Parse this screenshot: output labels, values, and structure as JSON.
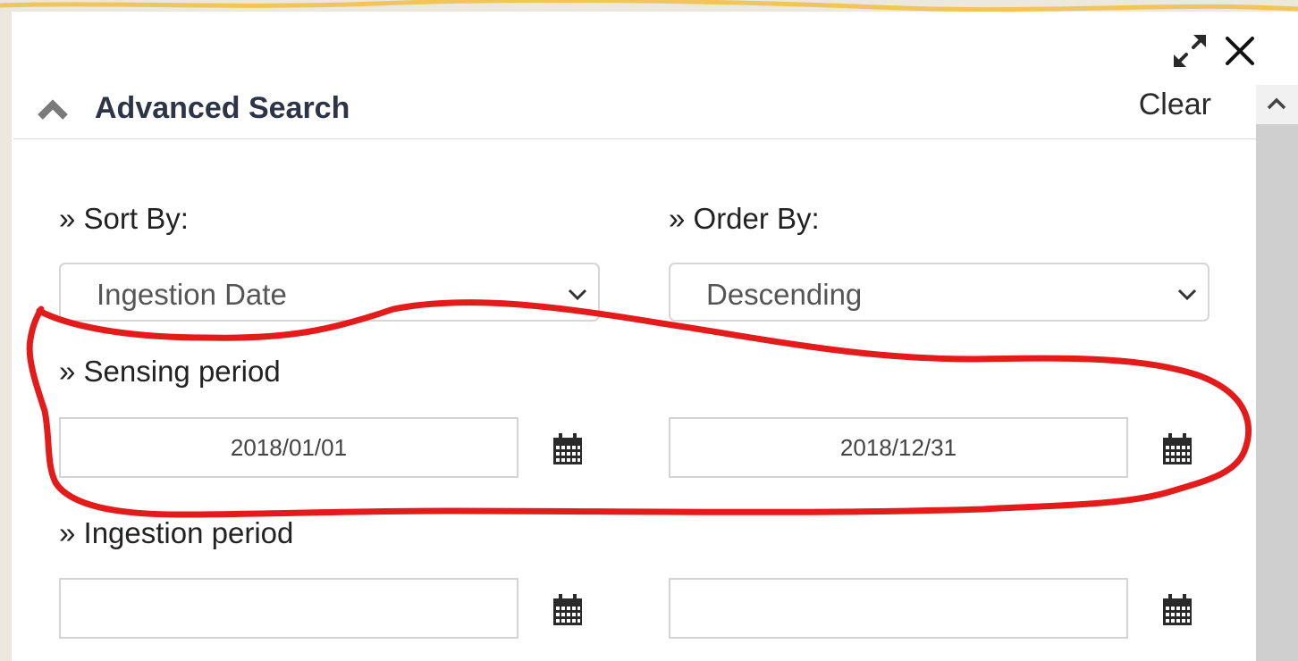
{
  "window": {
    "expand_icon": "expand-arrows-icon",
    "close_icon": "close-icon"
  },
  "header": {
    "title": "Advanced Search",
    "clear_label": "Clear",
    "collapse_icon": "chevron-up-icon"
  },
  "sort_by": {
    "label": "» Sort By:",
    "selected": "Ingestion Date"
  },
  "order_by": {
    "label": "» Order By:",
    "selected": "Descending"
  },
  "sensing_period": {
    "label": "» Sensing period",
    "start": "2018/01/01",
    "end": "2018/12/31"
  },
  "ingestion_period": {
    "label": "» Ingestion period",
    "start": "",
    "end": ""
  },
  "colors": {
    "title": "#2e3447",
    "annotation": "#e31b1b",
    "icon": "#2a2a2a"
  }
}
